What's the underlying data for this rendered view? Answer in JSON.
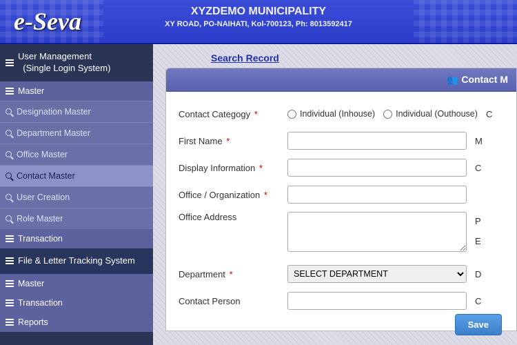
{
  "header": {
    "logo": "e-Seva",
    "municipality_name": "XYZDEMO MUNICIPALITY",
    "municipality_address": "XY ROAD, PO-NAIHATI, Kol-700123, Ph: 8013592417"
  },
  "sidebar": {
    "section1": {
      "title": "User Management",
      "subtitle": "(Single Login System)",
      "master_label": "Master",
      "items": [
        "Designation Master",
        "Department Master",
        "Office Master",
        "Contact Master",
        "User Creation",
        "Role Master"
      ],
      "transaction_label": "Transaction"
    },
    "section2": {
      "title": "File & Letter Tracking System",
      "groups": [
        "Master",
        "Transaction",
        "Reports"
      ]
    }
  },
  "content": {
    "search_link": "Search Record",
    "panel_title": "Contact M",
    "labels": {
      "category": "Contact Categogy",
      "first_name": "First Name",
      "display_info": "Display Information",
      "office_org": "Office / Organization",
      "office_addr": "Office Address",
      "department": "Department",
      "contact_person": "Contact Person"
    },
    "radios": {
      "inhouse": "Individual (Inhouse)",
      "outhouse": "Individual (Outhouse)",
      "other": "C"
    },
    "trails": {
      "first_name": "M",
      "display_info": "C",
      "office_addr1": "P",
      "dept": "D",
      "contact_person": "C"
    },
    "e_trail": "E",
    "dept_options": [
      "SELECT DEPARTMENT"
    ],
    "save": "Save"
  }
}
